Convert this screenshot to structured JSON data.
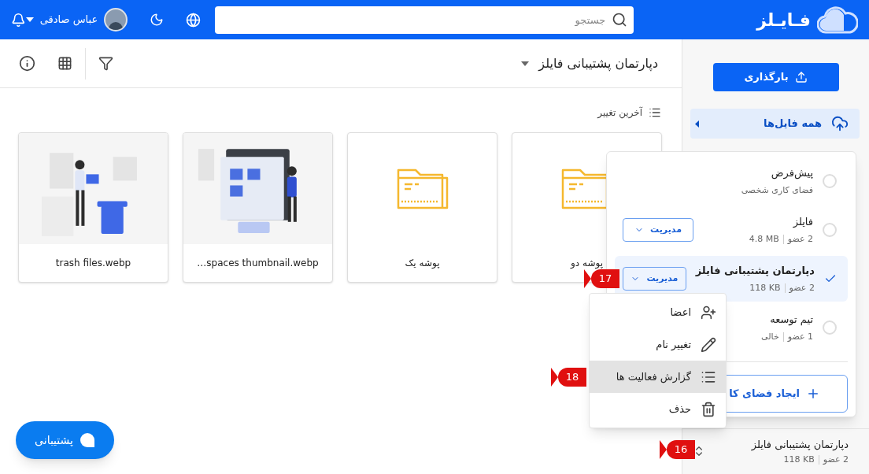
{
  "header": {
    "logo_text": "فـایـلز",
    "search": {
      "placeholder": "جستجو"
    },
    "user": {
      "name": "عباس صادقی"
    }
  },
  "sidebar": {
    "upload_button": "بارگذاری",
    "nav": [
      {
        "label": "همه فایل‌ها",
        "selected": true
      }
    ],
    "current_workspace": {
      "name": "دپارتمان پشتیبانی فایلز",
      "members": "2 عضو",
      "size": "118 KB"
    }
  },
  "toolbar": {
    "title": "دپارتمان پشتیبانی فایلز"
  },
  "sort": {
    "label": "آخرین تغییر"
  },
  "files": [
    {
      "kind": "folder",
      "name": "پوشه دو"
    },
    {
      "kind": "folder",
      "name": "پوشه یک"
    },
    {
      "kind": "picture",
      "name": "…spaces thumbnail.webp"
    },
    {
      "kind": "picture",
      "name": "trash files.webp"
    }
  ],
  "workspace_menu": {
    "items": [
      {
        "name": "پیش‌فرض",
        "subtitle": "فضای کاری شخصی",
        "selected": false
      },
      {
        "name": "فایلز",
        "members": "2 عضو",
        "size": "4.8 MB",
        "manage_button": "مدیریت",
        "selected": false
      },
      {
        "name": "دپارتمان پشتیبانی فایلز",
        "members": "2 عضو",
        "size": "118 KB",
        "manage_button": "مدیریت",
        "selected": true
      },
      {
        "name": "تیم توسعه",
        "members": "1 عضو",
        "size": "خالی",
        "selected": false
      }
    ],
    "create_button": "ایجاد فضای کا"
  },
  "context_menu": {
    "items": [
      {
        "kind": "members",
        "label": "اعضا",
        "selected": false
      },
      {
        "kind": "rename",
        "label": "تغییر نام",
        "selected": false
      },
      {
        "kind": "activity",
        "label": "گزارش فعالیت ها",
        "selected": true
      },
      {
        "kind": "delete",
        "label": "حذف",
        "selected": false
      }
    ]
  },
  "support_button": "پشتیبانی",
  "callouts": [
    "17",
    "18",
    "16"
  ]
}
